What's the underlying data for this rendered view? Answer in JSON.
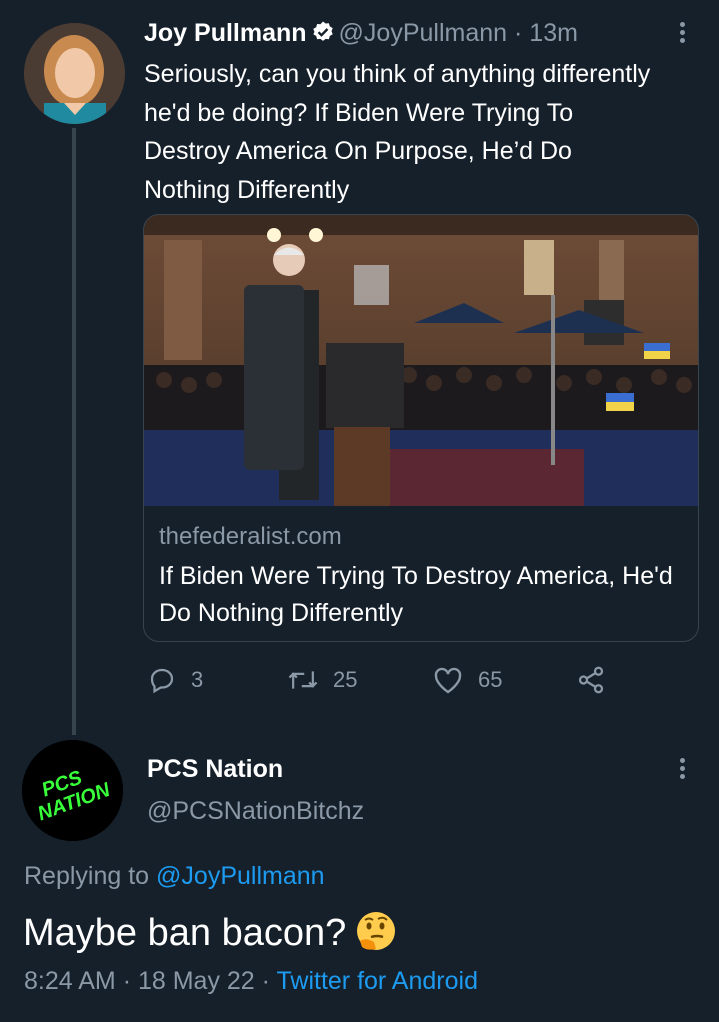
{
  "tweet": {
    "name": "Joy Pullmann",
    "handle": "@JoyPullmann",
    "separator": "·",
    "time": "13m",
    "text": "Seriously, can you think of anything differently he'd be doing? If Biden Were Trying To Destroy America On Purpose, He’d Do Nothing Differently",
    "card": {
      "domain": "thefederalist.com",
      "title": "If Biden Were Trying To Destroy America, He'd Do Nothing Differently"
    },
    "actions": {
      "replies": "3",
      "retweets": "25",
      "likes": "65"
    },
    "icons": [
      "verified-icon",
      "more-icon",
      "reply-icon",
      "retweet-icon",
      "like-icon",
      "share-icon"
    ]
  },
  "reply": {
    "name": "PCS Nation",
    "handle": "@PCSNationBitchz",
    "avatar_text": "PCS NATION",
    "replying_prefix": "Replying to",
    "replying_to": "@JoyPullmann",
    "text": "Maybe ban bacon?",
    "emoji": "thinking-face-emoji",
    "time": "8:24 AM",
    "sep1": "·",
    "date": "18 May 22",
    "sep2": "·",
    "source": "Twitter for Android"
  },
  "colors": {
    "background": "#15202b",
    "accent": "#1d9bf0",
    "muted": "#8b98a5",
    "border": "#38444d"
  }
}
